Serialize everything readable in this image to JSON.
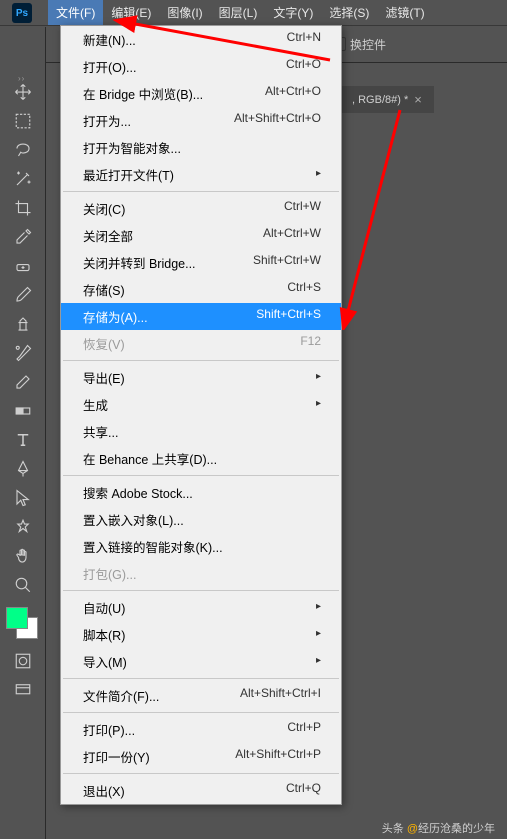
{
  "app": {
    "ps_label": "Ps"
  },
  "menubar": {
    "items": [
      {
        "label": "文件(F)",
        "active": true
      },
      {
        "label": "编辑(E)"
      },
      {
        "label": "图像(I)"
      },
      {
        "label": "图层(L)"
      },
      {
        "label": "文字(Y)"
      },
      {
        "label": "选择(S)"
      },
      {
        "label": "滤镜(T)"
      }
    ]
  },
  "options": {
    "transform_controls": "换控件"
  },
  "document": {
    "tab_label": ", RGB/8#) *",
    "close": "×"
  },
  "dropdown": {
    "items": [
      {
        "label": "新建(N)...",
        "shortcut": "Ctrl+N"
      },
      {
        "label": "打开(O)...",
        "shortcut": "Ctrl+O"
      },
      {
        "label": "在 Bridge 中浏览(B)...",
        "shortcut": "Alt+Ctrl+O"
      },
      {
        "label": "打开为...",
        "shortcut": "Alt+Shift+Ctrl+O"
      },
      {
        "label": "打开为智能对象..."
      },
      {
        "label": "最近打开文件(T)",
        "submenu": true
      },
      {
        "sep": true
      },
      {
        "label": "关闭(C)",
        "shortcut": "Ctrl+W"
      },
      {
        "label": "关闭全部",
        "shortcut": "Alt+Ctrl+W"
      },
      {
        "label": "关闭并转到 Bridge...",
        "shortcut": "Shift+Ctrl+W"
      },
      {
        "label": "存储(S)",
        "shortcut": "Ctrl+S"
      },
      {
        "label": "存储为(A)...",
        "shortcut": "Shift+Ctrl+S",
        "highlighted": true
      },
      {
        "label": "恢复(V)",
        "shortcut": "F12",
        "disabled": true
      },
      {
        "sep": true
      },
      {
        "label": "导出(E)",
        "submenu": true
      },
      {
        "label": "生成",
        "submenu": true
      },
      {
        "label": "共享..."
      },
      {
        "label": "在 Behance 上共享(D)..."
      },
      {
        "sep": true
      },
      {
        "label": "搜索 Adobe Stock..."
      },
      {
        "label": "置入嵌入对象(L)..."
      },
      {
        "label": "置入链接的智能对象(K)..."
      },
      {
        "label": "打包(G)...",
        "disabled": true
      },
      {
        "sep": true
      },
      {
        "label": "自动(U)",
        "submenu": true
      },
      {
        "label": "脚本(R)",
        "submenu": true
      },
      {
        "label": "导入(M)",
        "submenu": true
      },
      {
        "sep": true
      },
      {
        "label": "文件简介(F)...",
        "shortcut": "Alt+Shift+Ctrl+I"
      },
      {
        "sep": true
      },
      {
        "label": "打印(P)...",
        "shortcut": "Ctrl+P"
      },
      {
        "label": "打印一份(Y)",
        "shortcut": "Alt+Shift+Ctrl+P"
      },
      {
        "sep": true
      },
      {
        "label": "退出(X)",
        "shortcut": "Ctrl+Q"
      }
    ]
  },
  "watermark": {
    "prefix": "头条",
    "at": "@",
    "name": "经历沧桑的少年"
  }
}
